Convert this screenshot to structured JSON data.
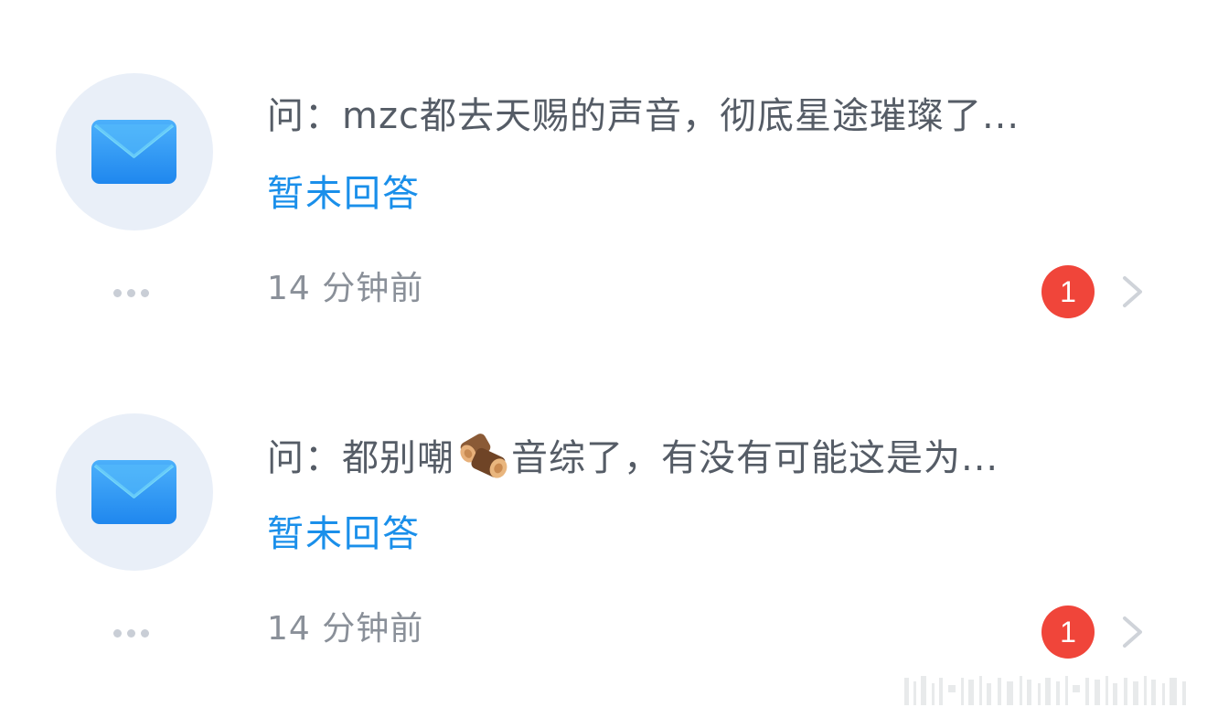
{
  "messages": [
    {
      "avatar_icon": "envelope-icon",
      "question_prefix": "问：",
      "question_text": "mzc都去天赐的声音，彻底星途璀璨了...",
      "question_text_after_icon": "",
      "has_inline_icon": false,
      "status": "暂未回答",
      "time": "14 分钟前",
      "badge_count": "1"
    },
    {
      "avatar_icon": "envelope-icon",
      "question_prefix": "问：",
      "question_text": "都别嘲",
      "inline_icon": "wood-log-emoji",
      "question_text_after_icon": "音综了，有没有可能这是为...",
      "has_inline_icon": true,
      "status": "暂未回答",
      "time": "14 分钟前",
      "badge_count": "1"
    }
  ],
  "colors": {
    "status_blue": "#1a8fea",
    "badge_red": "#f0453a",
    "avatar_bg": "#e9eff8",
    "envelope_blue": "#2f9bf5"
  }
}
